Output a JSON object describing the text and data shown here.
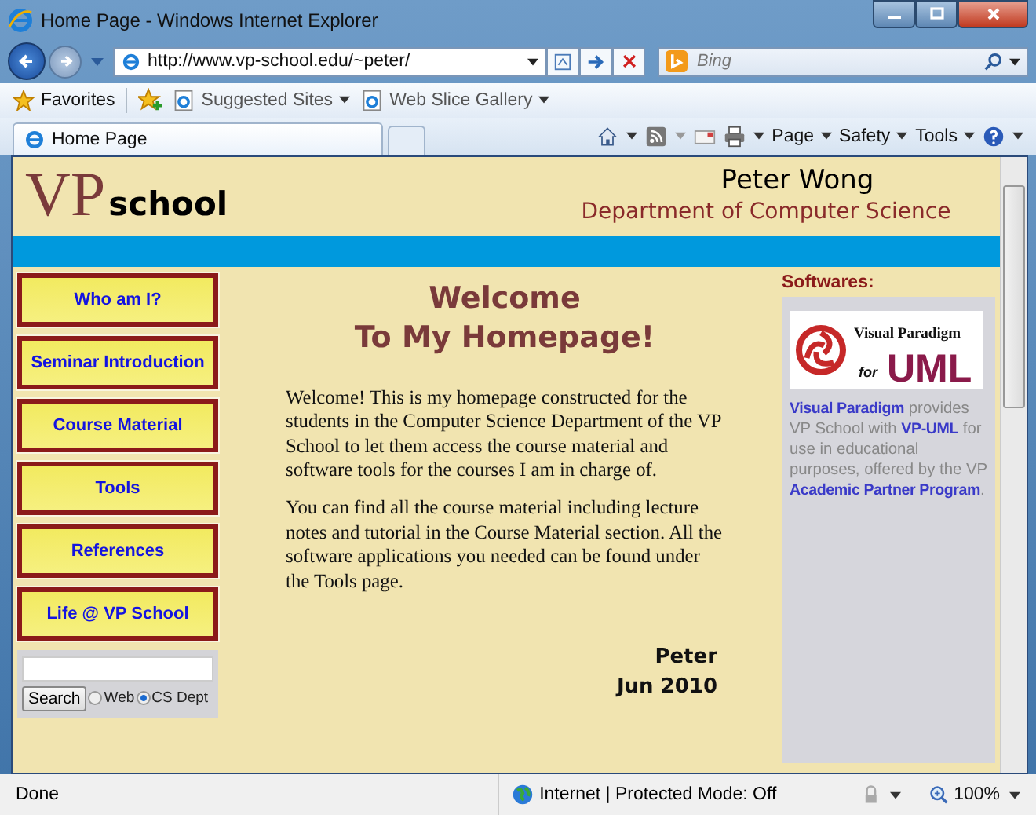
{
  "window": {
    "title": "Home Page - Windows Internet Explorer"
  },
  "address_bar": {
    "url": "http://www.vp-school.edu/~peter/"
  },
  "search": {
    "placeholder": "Bing"
  },
  "favorites_bar": {
    "label": "Favorites",
    "items": [
      "Suggested Sites",
      "Web Slice Gallery"
    ]
  },
  "tabs": [
    {
      "label": "Home Page",
      "selected": true
    }
  ],
  "command_bar": [
    "Page",
    "Safety",
    "Tools"
  ],
  "page": {
    "logo": {
      "big": "VP",
      "small": "school"
    },
    "name": "Peter Wong",
    "department": "Department of Computer Science",
    "nav": [
      "Who am I?",
      "Seminar Introduction",
      "Course Material",
      "Tools",
      "References",
      "Life @ VP School"
    ],
    "search": {
      "button": "Search",
      "options": [
        {
          "label": "Web",
          "selected": false
        },
        {
          "label": "CS Dept",
          "selected": true
        }
      ]
    },
    "heading": [
      "Welcome",
      "To My Homepage!"
    ],
    "paragraphs": [
      "Welcome! This is my homepage constructed for the students in the Computer Science Department of the VP School to let them access the course material and software tools for the courses I am in charge of.",
      "You can find all the course material including lecture notes and tutorial in the Course Material section. All the software applications you needed can be found under the Tools page."
    ],
    "signature": [
      "Peter",
      "Jun 2010"
    ],
    "sidebar": {
      "title": "Softwares:",
      "logo": {
        "brand": "Visual Paradigm",
        "for": "for",
        "product": "UML"
      },
      "blurb": [
        {
          "kind": "link",
          "text": "Visual Paradigm"
        },
        {
          "kind": "text",
          "text": " provides VP School with "
        },
        {
          "kind": "link",
          "text": "VP-UML"
        },
        {
          "kind": "text",
          "text": "  for use in educational purposes, offered by the VP "
        },
        {
          "kind": "link",
          "text": "Academic Partner Program"
        },
        {
          "kind": "text",
          "text": "."
        }
      ]
    }
  },
  "status_bar": {
    "text": "Done",
    "zone": "Internet | Protected Mode: Off",
    "zoom": "100%"
  }
}
